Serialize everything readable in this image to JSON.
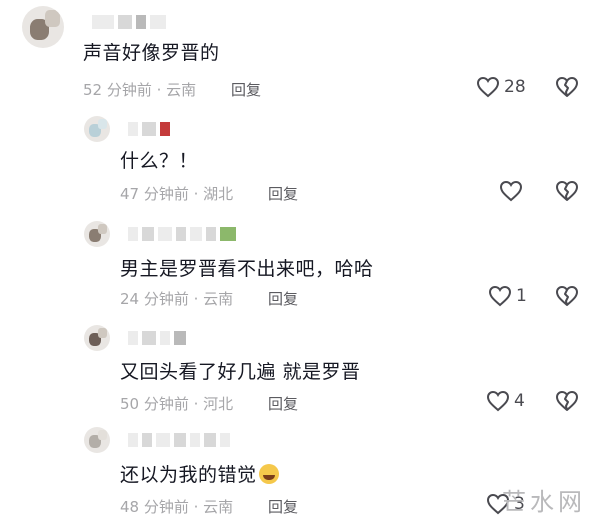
{
  "comments": [
    {
      "text": "声音好像罗晋的",
      "time": "52 分钟前",
      "location": "云南",
      "reply_label": "回复",
      "likes": "28",
      "dislike_icon": "broken-heart-icon"
    },
    {
      "text": "什么？！",
      "time": "47 分钟前",
      "location": "湖北",
      "reply_label": "回复",
      "likes": "",
      "dislike_icon": "broken-heart-icon"
    },
    {
      "text": "男主是罗晋看不出来吧，哈哈",
      "time": "24 分钟前",
      "location": "云南",
      "reply_label": "回复",
      "likes": "1",
      "dislike_icon": "broken-heart-icon"
    },
    {
      "text": "又回头看了好几遍 就是罗晋",
      "time": "50 分钟前",
      "location": "河北",
      "reply_label": "回复",
      "likes": "4",
      "dislike_icon": "broken-heart-icon"
    },
    {
      "text": "还以为我的错觉",
      "time": "48 分钟前",
      "location": "云南",
      "reply_label": "回复",
      "likes": "3",
      "dislike_icon": "broken-heart-icon",
      "emoji": "crying-laughing-emoji"
    }
  ],
  "watermark": "芒水网",
  "colors": {
    "text": "#161823",
    "meta": "#a6a6a9",
    "icon": "#4a4a50"
  }
}
